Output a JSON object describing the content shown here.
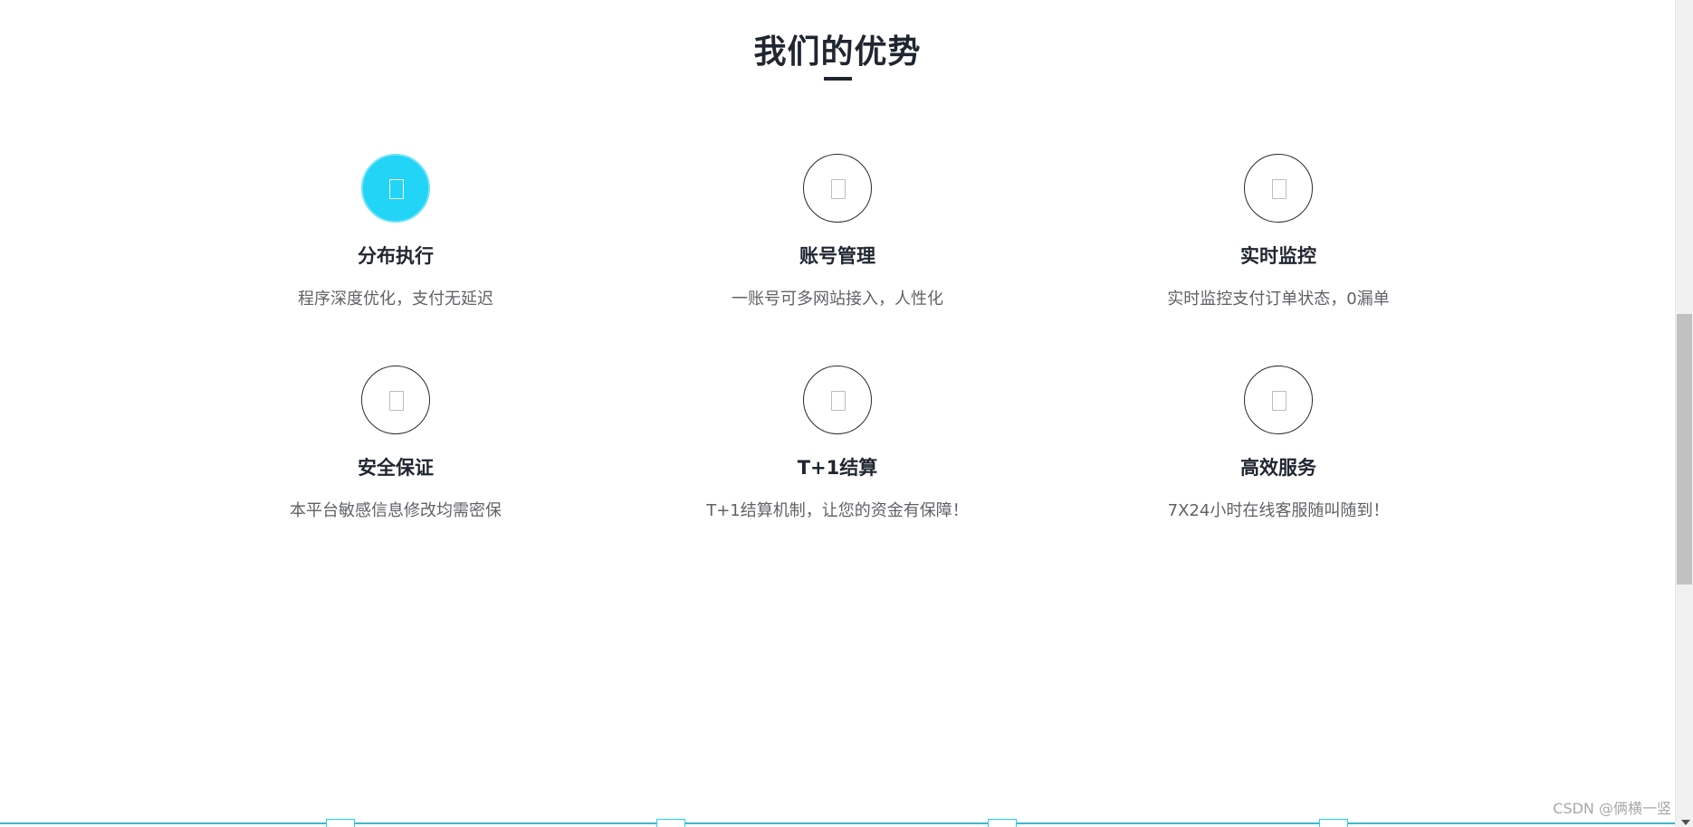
{
  "section": {
    "title": "我们的优势"
  },
  "features": [
    {
      "title": "分布执行",
      "description": "程序深度优化，支付无延迟",
      "active": true
    },
    {
      "title": "账号管理",
      "description": "一账号可多网站接入，人性化",
      "active": false
    },
    {
      "title": "实时监控",
      "description": "实时监控支付订单状态，0漏单",
      "active": false
    },
    {
      "title": "安全保证",
      "description": "本平台敏感信息修改均需密保",
      "active": false
    },
    {
      "title": "T+1结算",
      "description": "T+1结算机制，让您的资金有保障！",
      "active": false
    },
    {
      "title": "高效服务",
      "description": "7X24小时在线客服随叫随到！",
      "active": false
    }
  ],
  "watermark": {
    "text": "CSDN @俩横一竖"
  },
  "colors": {
    "accent": "#22d4f5",
    "title": "#1f2630",
    "description": "#606266"
  }
}
